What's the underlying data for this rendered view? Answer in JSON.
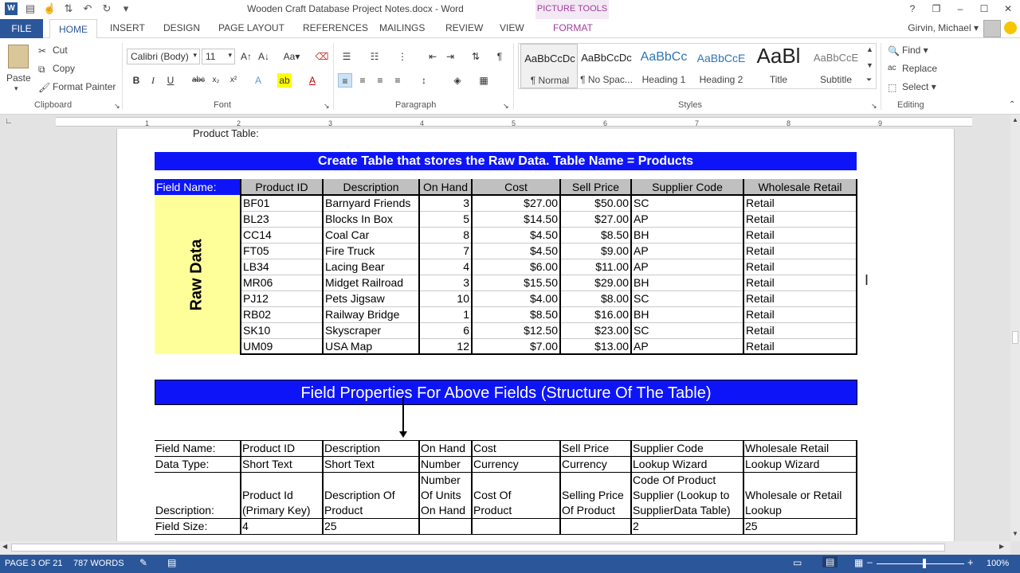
{
  "window": {
    "title": "Wooden Craft Database Project Notes.docx - Word",
    "contextual_group": "PICTURE TOOLS",
    "controls": [
      "?",
      "❐",
      "–",
      "❐",
      "✕"
    ]
  },
  "tabs": {
    "file": "FILE",
    "home": "HOME",
    "insert": "INSERT",
    "design": "DESIGN",
    "page_layout": "PAGE LAYOUT",
    "references": "REFERENCES",
    "mailings": "MAILINGS",
    "review": "REVIEW",
    "view": "VIEW",
    "format": "FORMAT"
  },
  "user": {
    "name": "Girvin, Michael"
  },
  "clipboard": {
    "paste": "Paste",
    "cut": "Cut",
    "copy": "Copy",
    "format_painter": "Format Painter",
    "label": "Clipboard"
  },
  "font": {
    "name": "Calibri (Body)",
    "size": "11",
    "label": "Font"
  },
  "paragraph": {
    "label": "Paragraph"
  },
  "styles": {
    "label": "Styles",
    "items": [
      {
        "sample": "AaBbCcDc",
        "name": "¶ Normal"
      },
      {
        "sample": "AaBbCcDc",
        "name": "¶ No Spac..."
      },
      {
        "sample": "AaBbCc",
        "name": "Heading 1"
      },
      {
        "sample": "AaBbCcE",
        "name": "Heading 2"
      },
      {
        "sample": "AaBl",
        "name": "Title"
      },
      {
        "sample": "AaBbCcE",
        "name": "Subtitle"
      }
    ]
  },
  "editing": {
    "find": "Find",
    "replace": "Replace",
    "select": "Select",
    "label": "Editing"
  },
  "ruler": {
    "numbers": [
      "1",
      "2",
      "3",
      "4",
      "5",
      "6",
      "7",
      "8",
      "9"
    ]
  },
  "document": {
    "top_text": "Product Table:",
    "banner1": "Create Table that stores the Raw Data. Table Name = Products",
    "raw_label": "Raw Data",
    "field_name_label": "Field Name:",
    "raw_headers": [
      "Product ID",
      "Description",
      "On Hand",
      "Cost",
      "Sell Price",
      "Supplier Code",
      "Wholesale Retail"
    ],
    "raw_rows": [
      [
        "BF01",
        "Barnyard Friends",
        "3",
        "$27.00",
        "$50.00",
        "SC",
        "Retail"
      ],
      [
        "BL23",
        "Blocks In Box",
        "5",
        "$14.50",
        "$27.00",
        "AP",
        "Retail"
      ],
      [
        "CC14",
        "Coal Car",
        "8",
        "$4.50",
        "$8.50",
        "BH",
        "Retail"
      ],
      [
        "FT05",
        "Fire Truck",
        "7",
        "$4.50",
        "$9.00",
        "AP",
        "Retail"
      ],
      [
        "LB34",
        "Lacing Bear",
        "4",
        "$6.00",
        "$11.00",
        "AP",
        "Retail"
      ],
      [
        "MR06",
        "Midget Railroad",
        "3",
        "$15.50",
        "$29.00",
        "BH",
        "Retail"
      ],
      [
        "PJ12",
        "Pets Jigsaw",
        "10",
        "$4.00",
        "$8.00",
        "SC",
        "Retail"
      ],
      [
        "RB02",
        "Railway Bridge",
        "1",
        "$8.50",
        "$16.00",
        "BH",
        "Retail"
      ],
      [
        "SK10",
        "Skyscraper",
        "6",
        "$12.50",
        "$23.00",
        "SC",
        "Retail"
      ],
      [
        "UM09",
        "USA Map",
        "12",
        "$7.00",
        "$13.00",
        "AP",
        "Retail"
      ]
    ],
    "banner2": "Field Properties For Above Fields (Structure Of The Table)",
    "props_rows": [
      [
        "Field Name:",
        "Product ID",
        "Description",
        "On Hand",
        "Cost",
        "Sell Price",
        "Supplier Code",
        "Wholesale Retail"
      ],
      [
        "Data Type:",
        "Short Text",
        "Short Text",
        "Number",
        "Currency",
        "Currency",
        "Lookup Wizard",
        "Lookup Wizard"
      ],
      [
        "Description:",
        "Product Id\n(Primary Key)",
        "Description Of\nProduct",
        "Number\nOf Units\nOn Hand",
        "Cost Of\nProduct",
        "Selling Price\nOf Product",
        "Code Of Product\nSupplier (Lookup to\nSupplierData Table)",
        "Wholesale or Retail\nLookup"
      ],
      [
        "Field Size:",
        "4",
        "25",
        "",
        "",
        "",
        "2",
        "25"
      ]
    ]
  },
  "status": {
    "page": "PAGE 3 OF 21",
    "words": "787 WORDS",
    "zoom": "100%"
  },
  "colors": {
    "word_blue": "#2b579a",
    "banner_blue": "#0d15f8",
    "raw_yellow": "#ffff99",
    "header_gray": "#c0c0c0",
    "picture_tools": "#a23b9d"
  }
}
